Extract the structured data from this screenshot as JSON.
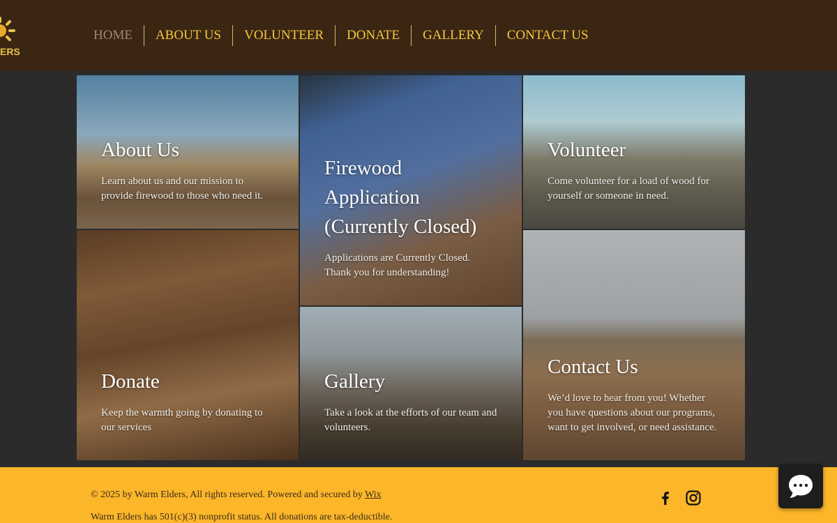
{
  "brand": {
    "logo_text": "ERS",
    "accent": "#e8c34a"
  },
  "nav": {
    "items": [
      {
        "label": "HOME",
        "active": true
      },
      {
        "label": "ABOUT US"
      },
      {
        "label": "VOLUNTEER"
      },
      {
        "label": "DONATE"
      },
      {
        "label": "GALLERY"
      },
      {
        "label": "CONTACT US"
      }
    ]
  },
  "tiles": {
    "about": {
      "title": "About Us",
      "desc_line1": "Learn about us and our mission to",
      "desc_line2": "provide firewood to those who need it."
    },
    "firewood": {
      "title_line1": "Firewood",
      "title_line2": "Application",
      "title_line3": "(Currently Closed)",
      "desc_line1": "Applications are Currently Closed.",
      "desc_line2": "Thank you for understanding!"
    },
    "volunteer": {
      "title": "Volunteer",
      "desc_line1": "Come volunteer for a load of wood for",
      "desc_line2": "yourself or someone in need."
    },
    "donate": {
      "title": "Donate",
      "desc_line1": "Keep the warmth going by donating to",
      "desc_line2": "our services"
    },
    "gallery": {
      "title": "Gallery",
      "desc_line1": "Take a look at the efforts of our team and",
      "desc_line2": "volunteers."
    },
    "contact": {
      "title": "Contact Us",
      "desc_line1": "We’d love to hear from you! Whether",
      "desc_line2": "you have questions about our programs,",
      "desc_line3": "want to get involved, or need assistance."
    }
  },
  "footer": {
    "copyright": "© 2025 by Warm Elders, All rights reserved. Powered and secured by ",
    "wix_link": "Wix",
    "note": "Warm Elders has 501(c)(3) nonprofit status. All donations are tax-deductible.",
    "bg_color": "#fcb62a"
  },
  "icons": {
    "facebook": "facebook-icon",
    "instagram": "instagram-icon",
    "chat": "chat-icon"
  }
}
